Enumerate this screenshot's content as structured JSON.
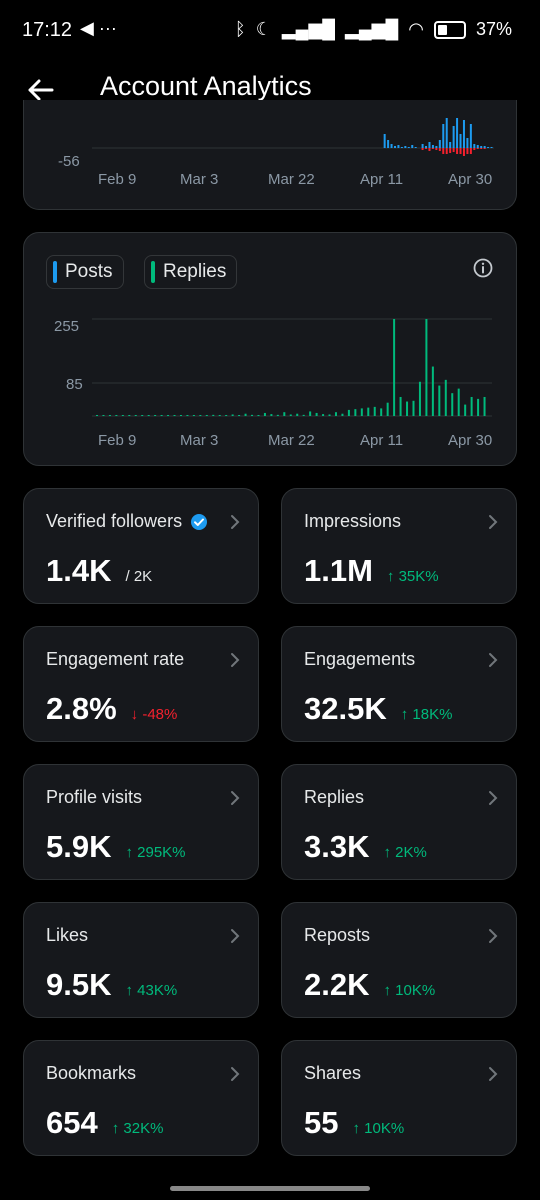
{
  "status_bar": {
    "time": "17:12",
    "left_icons": "◀ ···",
    "battery": "37%",
    "battery_level": 0.37
  },
  "header": {
    "title": "Account Analytics"
  },
  "top_chart": {
    "y_tick": "-56",
    "x_labels": [
      "Feb 9",
      "Mar 3",
      "Mar 22",
      "Apr 11",
      "Apr 30"
    ]
  },
  "chart_data": {
    "type": "bar",
    "legend": [
      "Posts",
      "Replies"
    ],
    "yticks": [
      255,
      85
    ],
    "ylim": [
      0,
      300
    ],
    "xlabels": [
      "Feb 9",
      "Mar 3",
      "Mar 22",
      "Apr 11",
      "Apr 30"
    ],
    "series": [
      {
        "name": "Replies",
        "color": "#00ba7c",
        "values": [
          1,
          0,
          1,
          0,
          0,
          1,
          0,
          0,
          0,
          2,
          0,
          1,
          0,
          0,
          2,
          0,
          1,
          0,
          3,
          0,
          2,
          4,
          1,
          6,
          3,
          2,
          8,
          5,
          3,
          10,
          4,
          6,
          3,
          12,
          8,
          5,
          4,
          10,
          6,
          16,
          18,
          20,
          22,
          24,
          20,
          35,
          255,
          50,
          38,
          40,
          90,
          255,
          130,
          80,
          95,
          60,
          72,
          30,
          50,
          45,
          50
        ]
      }
    ]
  },
  "chart_card": {
    "legend_posts": "Posts",
    "legend_replies": "Replies",
    "y_ticks": [
      "255",
      "85"
    ],
    "x_labels": [
      "Feb 9",
      "Mar 3",
      "Mar 22",
      "Apr 11",
      "Apr 30"
    ]
  },
  "stats": [
    {
      "label": "Verified followers",
      "value": "1.4K",
      "delta": "/ 2K",
      "delta_type": "muted",
      "verified": true
    },
    {
      "label": "Impressions",
      "value": "1.1M",
      "delta": "↑ 35K%",
      "delta_type": "up"
    },
    {
      "label": "Engagement rate",
      "value": "2.8%",
      "delta": "↓ -48%",
      "delta_type": "down"
    },
    {
      "label": "Engagements",
      "value": "32.5K",
      "delta": "↑ 18K%",
      "delta_type": "up"
    },
    {
      "label": "Profile visits",
      "value": "5.9K",
      "delta": "↑ 295K%",
      "delta_type": "up"
    },
    {
      "label": "Replies",
      "value": "3.3K",
      "delta": "↑ 2K%",
      "delta_type": "up"
    },
    {
      "label": "Likes",
      "value": "9.5K",
      "delta": "↑ 43K%",
      "delta_type": "up"
    },
    {
      "label": "Reposts",
      "value": "2.2K",
      "delta": "↑ 10K%",
      "delta_type": "up"
    },
    {
      "label": "Bookmarks",
      "value": "654",
      "delta": "↑ 32K%",
      "delta_type": "up"
    },
    {
      "label": "Shares",
      "value": "55",
      "delta": "↑ 10K%",
      "delta_type": "up"
    }
  ],
  "colors": {
    "background": "#000000",
    "card": "#16181c",
    "posts": "#1d9bf0",
    "replies": "#00ba7c",
    "negative": "#f4212e"
  }
}
